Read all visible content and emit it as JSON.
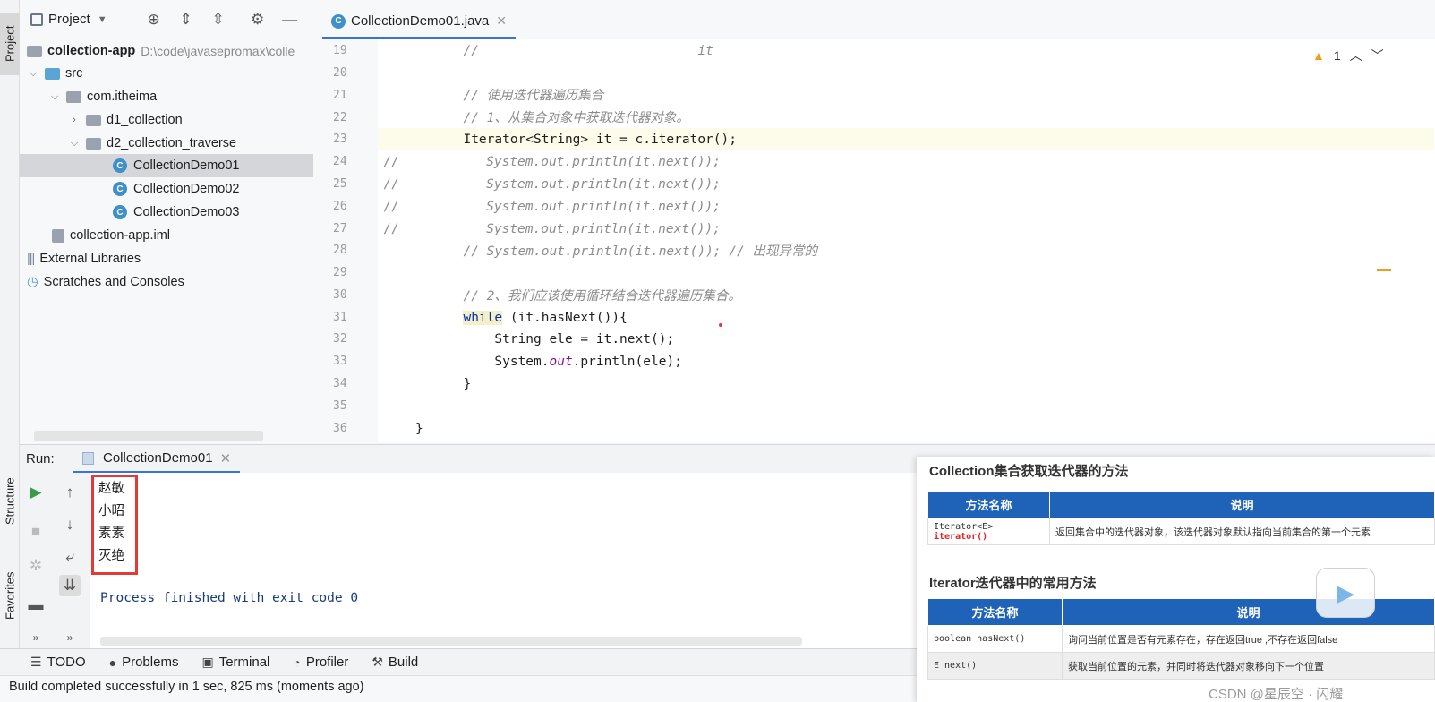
{
  "app": {
    "project_tool": "Project",
    "editor_tab": "CollectionDemo01.java"
  },
  "tree": {
    "root_name": "collection-app",
    "root_path": "D:\\code\\javasepromax\\colle",
    "items": [
      {
        "label": "src"
      },
      {
        "label": "com.itheima"
      },
      {
        "label": "d1_collection"
      },
      {
        "label": "d2_collection_traverse"
      },
      {
        "label": "CollectionDemo01"
      },
      {
        "label": "CollectionDemo02"
      },
      {
        "label": "CollectionDemo03"
      },
      {
        "label": "collection-app.iml"
      },
      {
        "label": "External Libraries"
      },
      {
        "label": "Scratches and Consoles"
      }
    ]
  },
  "editor": {
    "line_numbers": [
      "19",
      "20",
      "21",
      "22",
      "23",
      "24",
      "25",
      "26",
      "27",
      "28",
      "29",
      "30",
      "31",
      "32",
      "33",
      "34",
      "35",
      "36"
    ],
    "lines": {
      "l19": "  //                            it",
      "l21": "  // 使用迭代器遍历集合",
      "l22": "  // 1、从集合对象中获取迭代器对象。",
      "l23": "  Iterator<String> it = c.iterator();",
      "l24a": "//",
      "l24b": "     System.out.println(it.next());",
      "l25b": "     System.out.println(it.next());",
      "l26b": "     System.out.println(it.next());",
      "l27b": "     System.out.println(it.next());",
      "l28": "  // System.out.println(it.next()); // 出现异常的",
      "l30": "  // 2、我们应该使用循环结合迭代器遍历集合。",
      "l31_kw": "while",
      "l31_rest": " (it.hasNext()){",
      "l32": "      String ele = it.next();",
      "l33_a": "      System.",
      "l33_b": "out",
      "l33_c": ".println(ele);",
      "l34": "  }",
      "l36": "}"
    },
    "warning_count": "1"
  },
  "run": {
    "label": "Run:",
    "tab": "CollectionDemo01",
    "output": [
      "赵敏",
      "小昭",
      "素素",
      "灭绝"
    ],
    "process": "Process finished with exit code 0"
  },
  "bottom": {
    "todo": "TODO",
    "problems": "Problems",
    "terminal": "Terminal",
    "profiler": "Profiler",
    "build": "Build",
    "status": "Build completed successfully in 1 sec, 825 ms (moments ago)"
  },
  "side_tabs": {
    "project": "Project",
    "structure": "Structure",
    "favorites": "Favorites"
  },
  "slide": {
    "title1": "Collection集合获取迭代器的方法",
    "table1_head": [
      "方法名称",
      "说明"
    ],
    "table1_rows": [
      {
        "method_a": "Iterator<E> ",
        "method_b": "iterator()",
        "desc": "返回集合中的迭代器对象，该迭代器对象默认指向当前集合的第一个元素"
      }
    ],
    "title2": "Iterator迭代器中的常用方法",
    "table2_head": [
      "方法名称",
      "说明"
    ],
    "table2_rows": [
      {
        "method": "boolean hasNext()",
        "desc": "询问当前位置是否有元素存在，存在返回true ,不存在返回false"
      },
      {
        "method": "E next()",
        "desc": "获取当前位置的元素，并同时将迭代器对象移向下一个位置"
      }
    ],
    "watermark": "CSDN @星辰空 · 闪耀"
  }
}
